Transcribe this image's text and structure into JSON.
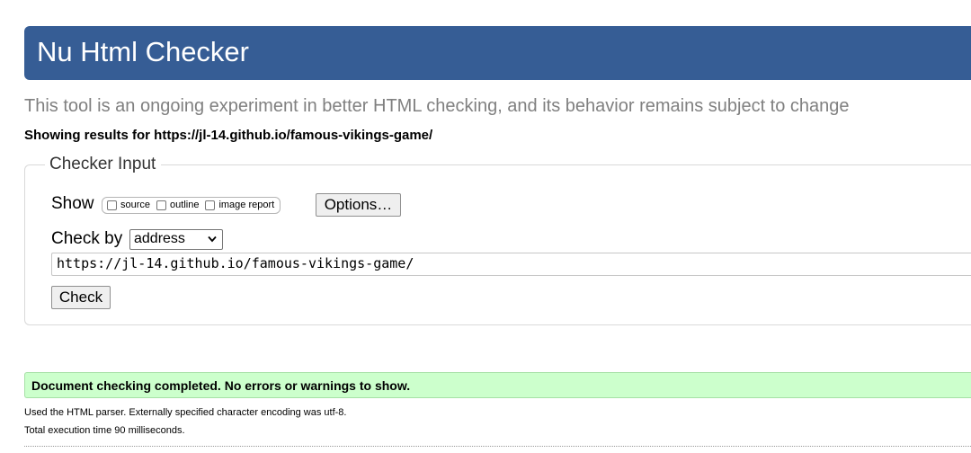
{
  "header": {
    "title": "Nu Html Checker",
    "subtitle": "This tool is an ongoing experiment in better HTML checking, and its behavior remains subject to change",
    "showing_results": "Showing results for https://jl-14.github.io/famous-vikings-game/"
  },
  "checker_input": {
    "legend": "Checker Input",
    "show_label": "Show",
    "show_options": [
      {
        "label": "source",
        "checked": false
      },
      {
        "label": "outline",
        "checked": false
      },
      {
        "label": "image report",
        "checked": false
      }
    ],
    "options_button": "Options…",
    "check_by_label": "Check by",
    "check_by_selected": "address",
    "url_value": "https://jl-14.github.io/famous-vikings-game/",
    "check_button": "Check"
  },
  "results": {
    "success_message": "Document checking completed. No errors or warnings to show.",
    "parser_info": "Used the HTML parser. Externally specified character encoding was utf-8.",
    "execution_time": "Total execution time 90 milliseconds."
  },
  "colors": {
    "banner": "#365d95",
    "success_bg": "#ccffcc",
    "subtitle_text": "#808080"
  },
  "icons": {
    "select_arrow": "chevron-down-icon"
  }
}
